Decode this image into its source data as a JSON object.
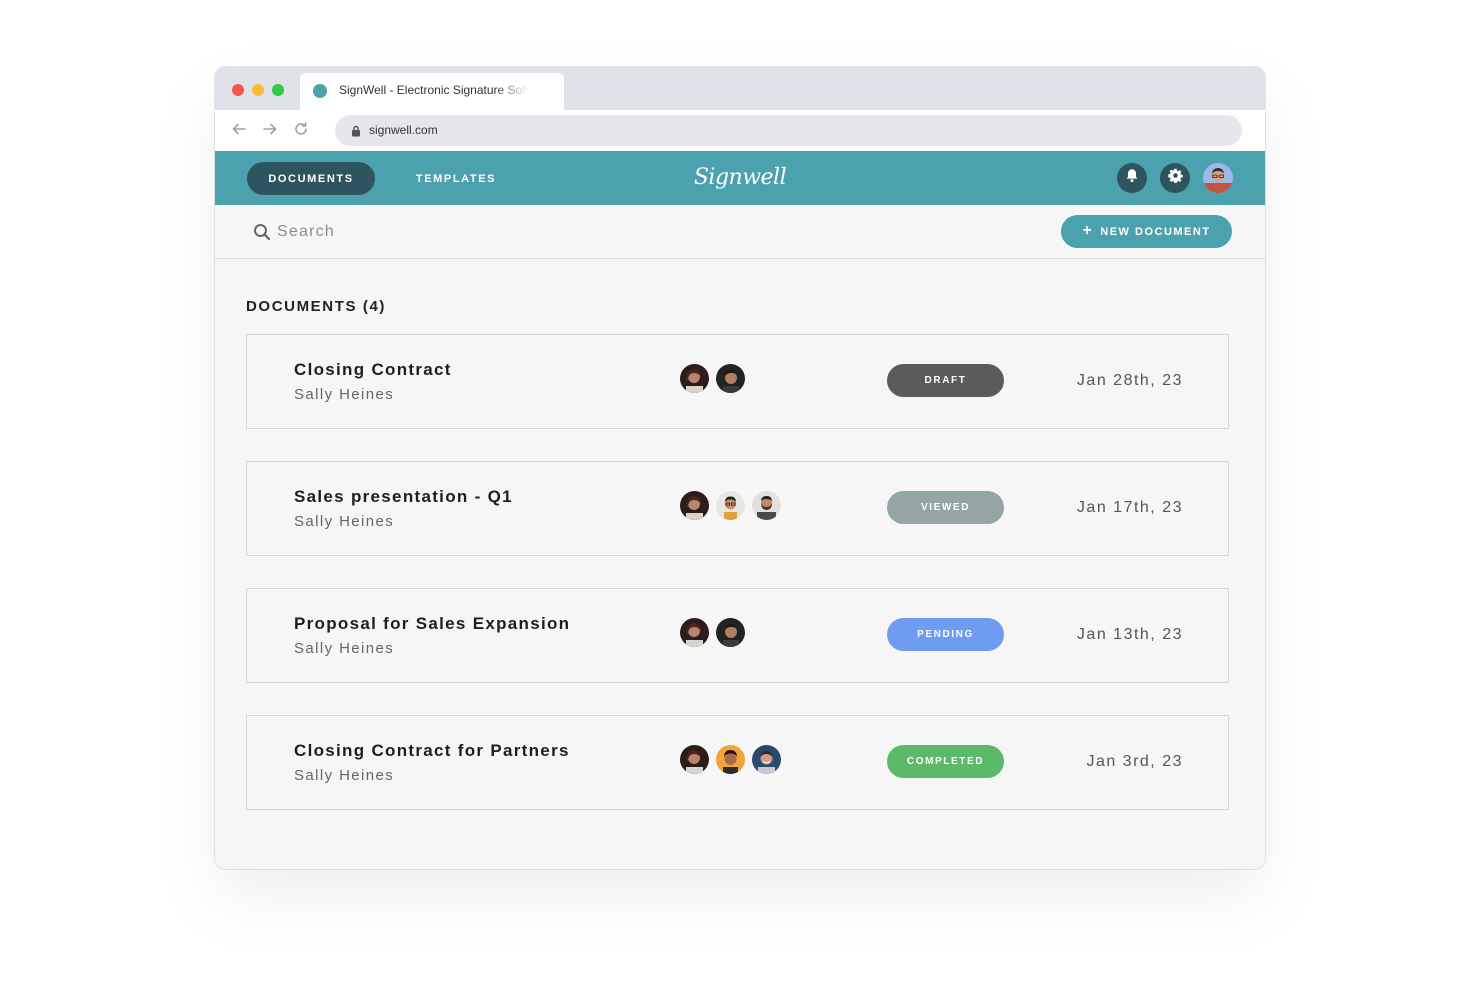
{
  "browser": {
    "tab_title": "SignWell - Electronic Signature Software",
    "url": "signwell.com"
  },
  "appbar": {
    "nav_documents": "DOCUMENTS",
    "nav_templates": "TEMPLATES",
    "logo_text": "Signwell",
    "accent_color": "#4ba2ae",
    "dark_color": "#2e5460"
  },
  "toolbar": {
    "search_placeholder": "Search",
    "new_document_label": "NEW DOCUMENT"
  },
  "documents_section": {
    "title": "DOCUMENTS",
    "count": "(4)"
  },
  "documents": [
    {
      "name": "Closing Contract",
      "owner": "Sally Heines",
      "status": "DRAFT",
      "status_color": "#5b5b5b",
      "date": "Jan 28th, 23",
      "signers": [
        "woman-dark-hair",
        "man-dark-hair"
      ]
    },
    {
      "name": "Sales presentation - Q1",
      "owner": "Sally Heines",
      "status": "VIEWED",
      "status_color": "#95a5a6",
      "date": "Jan 17th, 23",
      "signers": [
        "woman-dark-hair",
        "man-glasses",
        "man-beard"
      ]
    },
    {
      "name": "Proposal for Sales Expansion",
      "owner": "Sally Heines",
      "status": "PENDING",
      "status_color": "#6f9bf1",
      "date": "Jan 13th, 23",
      "signers": [
        "woman-dark-hair",
        "man-dark-hair"
      ]
    },
    {
      "name": "Closing Contract for Partners",
      "owner": "Sally Heines",
      "status": "COMPLETED",
      "status_color": "#5cb96a",
      "date": "Jan 3rd, 23",
      "signers": [
        "woman-dark-hair",
        "man-curly-hair",
        "man-blue-bg"
      ]
    }
  ]
}
